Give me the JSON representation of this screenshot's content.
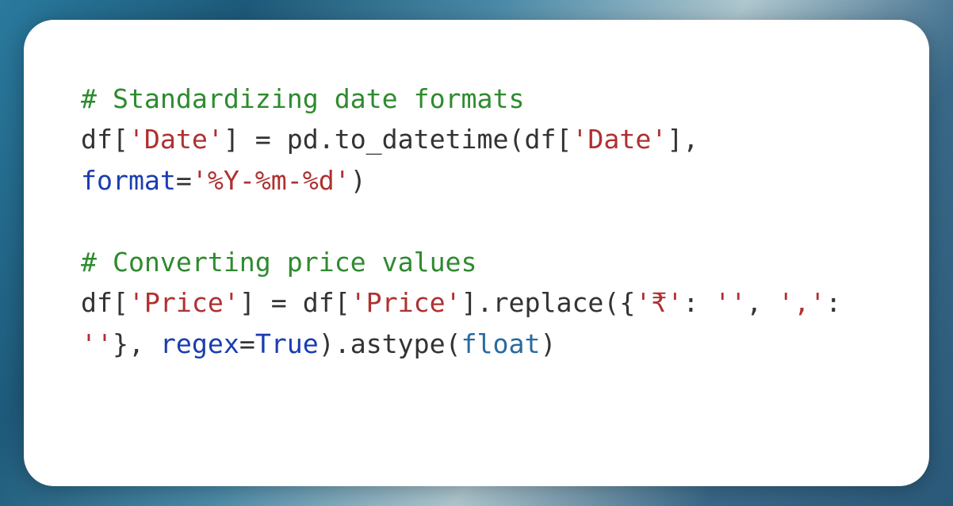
{
  "code": {
    "comment1": "# Standardizing date formats",
    "line2": {
      "p1": "df[",
      "s1": "'Date'",
      "p2": "] = pd.to_datetime(df[",
      "s2": "'Date'",
      "p3": "], ",
      "kw1": "format",
      "p4": "=",
      "s3": "'%Y-%m-%d'",
      "p5": ")"
    },
    "comment2": "# Converting price values",
    "line5": {
      "p1": "df[",
      "s1": "'Price'",
      "p2": "] = df[",
      "s2": "'Price'",
      "p3": "].replace({",
      "s3": "'₹'",
      "p4": ": ",
      "s4": "''",
      "p5": ", ",
      "s5": "','",
      "p6": ": ",
      "s6": "''",
      "p7": "}, ",
      "kw1": "regex",
      "p8": "=",
      "c1": "True",
      "p9": ").astype(",
      "b1": "float",
      "p10": ")"
    }
  }
}
